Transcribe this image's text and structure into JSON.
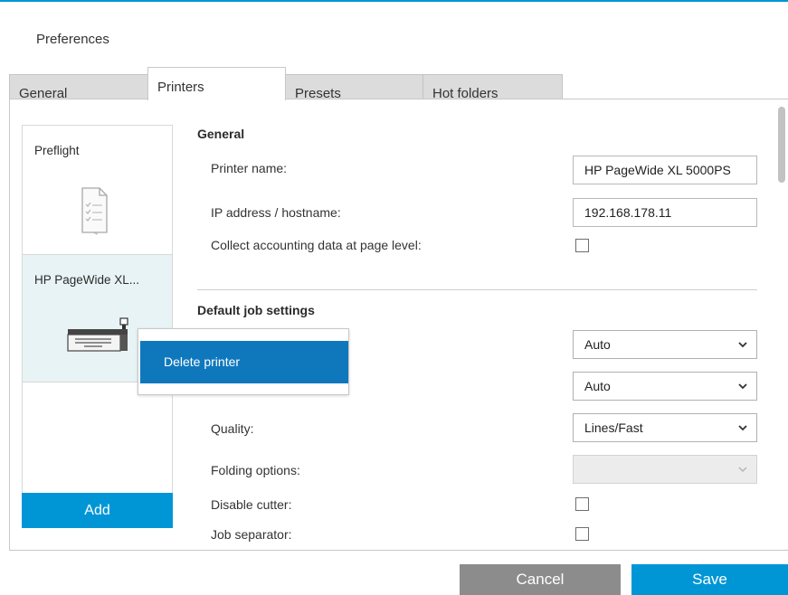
{
  "window": {
    "title": "Preferences"
  },
  "tabs": [
    {
      "label": "General",
      "active": false
    },
    {
      "label": "Printers",
      "active": true
    },
    {
      "label": "Presets",
      "active": false
    },
    {
      "label": "Hot folders",
      "active": false
    }
  ],
  "printers": [
    {
      "name": "Preflight",
      "icon": "document-pages-icon",
      "selected": false
    },
    {
      "name": "HP PageWide XL...",
      "icon": "large-format-printer-icon",
      "selected": true
    }
  ],
  "add_label": "Add",
  "context_menu": {
    "items": [
      {
        "label": "Delete printer"
      }
    ]
  },
  "general_section": {
    "title": "General",
    "printer_name_label": "Printer name:",
    "printer_name_value": "HP PageWide XL 5000PS",
    "ip_label": "IP address / hostname:",
    "ip_value": "192.168.178.11",
    "accounting_label": "Collect accounting data at page level:",
    "accounting_checked": false
  },
  "job_section": {
    "title": "Default job settings",
    "select1_value": "Auto",
    "select2_value": "Auto",
    "quality_label": "Quality:",
    "quality_value": "Lines/Fast",
    "folding_label": "Folding options:",
    "folding_value": "",
    "cutter_label": "Disable cutter:",
    "cutter_checked": false,
    "separator_label": "Job separator:",
    "separator_checked": false
  },
  "footer": {
    "cancel_label": "Cancel",
    "save_label": "Save"
  },
  "colors": {
    "accent": "#0096d6",
    "menu_highlight": "#0f78bd",
    "selected_card": "#e8f3f5",
    "cancel": "#8c8c8c"
  }
}
